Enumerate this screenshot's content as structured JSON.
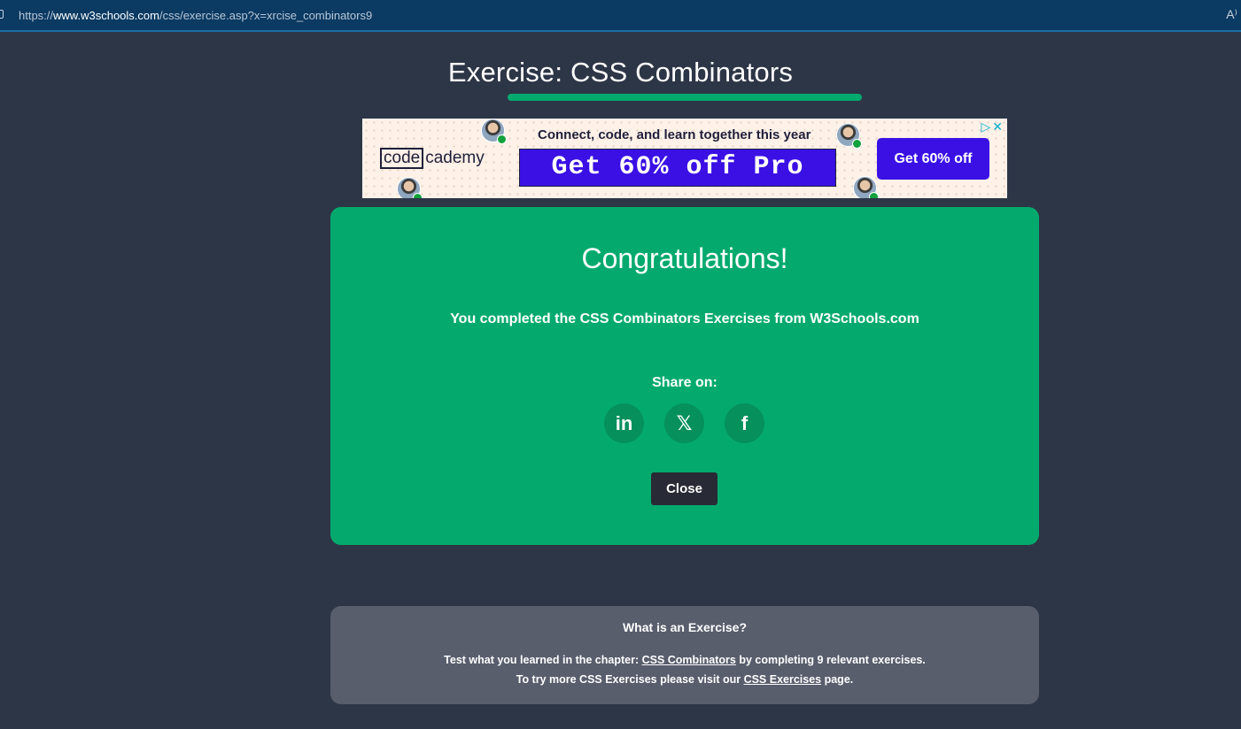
{
  "browser": {
    "url_prefix": "https://",
    "url_domain": "www.w3schools.com",
    "url_path": "/css/exercise.asp?x=xrcise_combinators9",
    "read_aloud_icon": "A⁾"
  },
  "page": {
    "title": "Exercise: CSS Combinators"
  },
  "ad": {
    "logo_boxed": "code",
    "logo_rest": "cademy",
    "tagline": "Connect, code, and learn together this year",
    "promo": "Get 60% off Pro",
    "cta": "Get 60% off",
    "adchoices_icon": "▷✕"
  },
  "congrats": {
    "heading": "Congratulations!",
    "message": "You completed the CSS Combinators Exercises from W3Schools.com",
    "share_label": "Share on:",
    "share_linkedin": "in",
    "share_x": "𝕏",
    "share_facebook": "f",
    "close_label": "Close"
  },
  "info": {
    "title": "What is an Exercise?",
    "line1_before": "Test what you learned in the chapter: ",
    "line1_link": "CSS Combinators",
    "line1_after": " by completing 9 relevant exercises.",
    "line2_before": "To try more CSS Exercises please visit our ",
    "line2_link": "CSS Exercises",
    "line2_after": " page."
  },
  "colors": {
    "background": "#2d3647",
    "accent_green": "#04aa6d",
    "ad_blue": "#3a10e5",
    "info_gray": "#585e6c"
  }
}
